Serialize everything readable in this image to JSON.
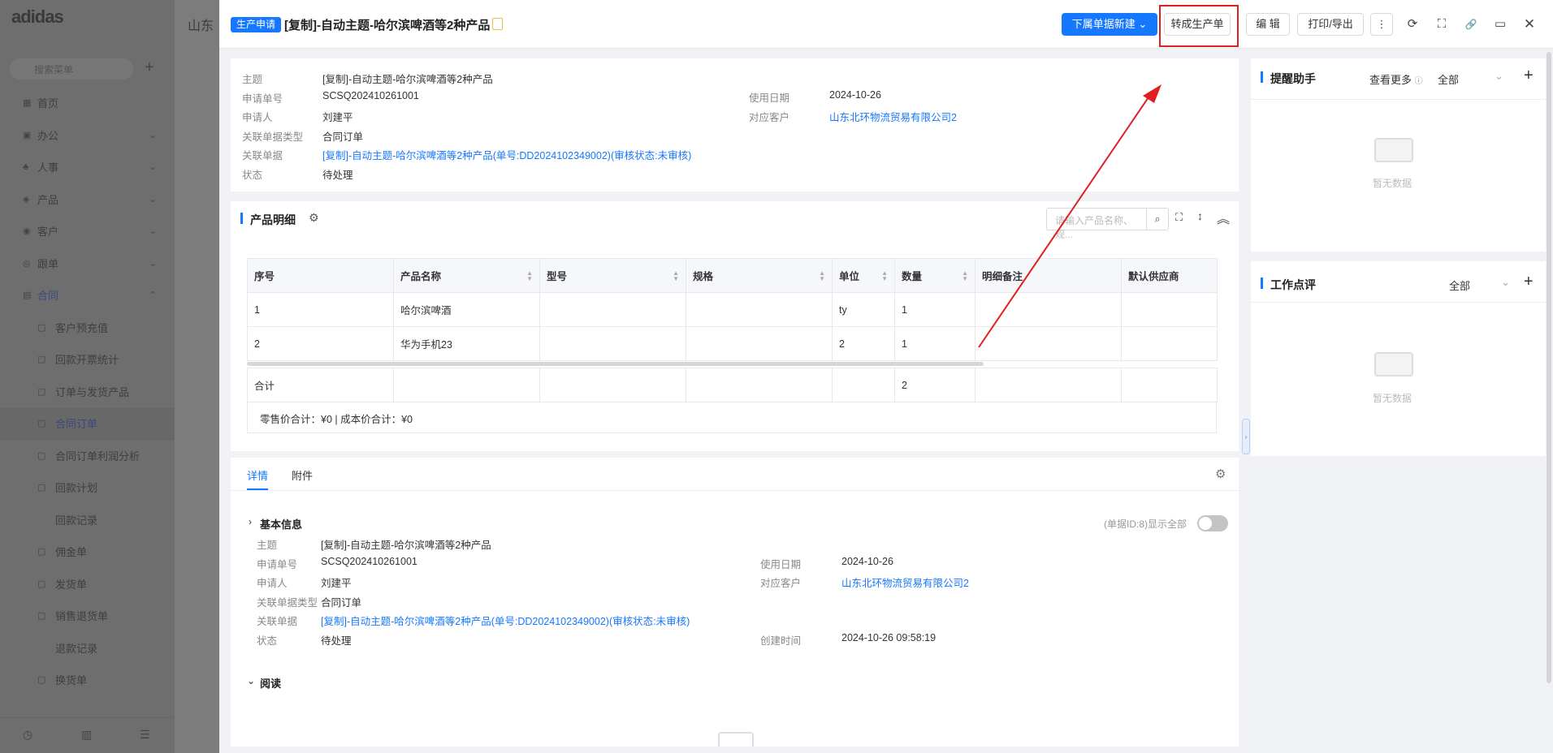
{
  "background": {
    "logo_text": "adidas",
    "search_placeholder": "搜索菜单",
    "header_text": "山东",
    "menu": [
      {
        "label": "首页",
        "icon": "▦",
        "arrow": ""
      },
      {
        "label": "办公",
        "icon": "▣",
        "arrow": "⌄"
      },
      {
        "label": "人事",
        "icon": "♣",
        "arrow": "⌄"
      },
      {
        "label": "产品",
        "icon": "◈",
        "arrow": "⌄"
      },
      {
        "label": "客户",
        "icon": "◉",
        "arrow": "⌄"
      },
      {
        "label": "跟单",
        "icon": "◎",
        "arrow": "⌄"
      },
      {
        "label": "合同",
        "icon": "▤",
        "arrow": "⌃"
      },
      {
        "label": "客户预充值",
        "icon": "▢",
        "arrow": ""
      },
      {
        "label": "回款开票统计",
        "icon": "▢",
        "arrow": ""
      },
      {
        "label": "订单与发货产品",
        "icon": "▢",
        "arrow": ""
      },
      {
        "label": "合同订单",
        "icon": "▢",
        "arrow": ""
      },
      {
        "label": "合同订单利润分析",
        "icon": "▢",
        "arrow": ""
      },
      {
        "label": "回款计划",
        "icon": "▢",
        "arrow": ""
      },
      {
        "label": "回款记录",
        "icon": "",
        "arrow": ""
      },
      {
        "label": "佣金单",
        "icon": "▢",
        "arrow": ""
      },
      {
        "label": "发货单",
        "icon": "▢",
        "arrow": ""
      },
      {
        "label": "销售退货单",
        "icon": "▢",
        "arrow": ""
      },
      {
        "label": "退款记录",
        "icon": "",
        "arrow": ""
      },
      {
        "label": "换货单",
        "icon": "▢",
        "arrow": ""
      }
    ]
  },
  "header": {
    "tag": "生产申请",
    "title": "[复制]-自动主题-哈尔滨啤酒等2种产品",
    "btn_new": "下属单据新建",
    "btn_convert": "转成生产单",
    "btn_edit": "编 辑",
    "btn_print": "打印/导出",
    "icons": {
      "more": "⋮",
      "refresh": "⟳",
      "fullscreen": "⛶",
      "link": "🔗",
      "panel": "▭",
      "close": "✕"
    }
  },
  "summary": {
    "rows": [
      {
        "label": "主题",
        "value": "[复制]-自动主题-哈尔滨啤酒等2种产品"
      },
      {
        "label": "申请单号",
        "value": "SCSQ202410261001"
      },
      {
        "label": "申请人",
        "value": "刘建平"
      },
      {
        "label": "关联单据类型",
        "value": "合同订单"
      },
      {
        "label": "关联单据",
        "value": "[复制]-自动主题-哈尔滨啤酒等2种产品(单号:DD2024102349002)(审核状态:未审核)"
      },
      {
        "label": "状态",
        "value": "待处理"
      }
    ],
    "right_rows": [
      {
        "label": "使用日期",
        "value": "2024-10-26"
      },
      {
        "label": "对应客户",
        "value": "山东北环物流贸易有限公司2"
      }
    ]
  },
  "products": {
    "title": "产品明细",
    "search_placeholder": "请输入产品名称、规...",
    "columns": [
      "序号",
      "产品名称",
      "型号",
      "规格",
      "单位",
      "数量",
      "明细备注",
      "默认供应商"
    ],
    "rows": [
      [
        "1",
        "哈尔滨啤酒",
        "",
        "",
        "ty",
        "1",
        "",
        ""
      ],
      [
        "2",
        "华为手机23",
        "",
        "",
        "2",
        "1",
        "",
        ""
      ]
    ],
    "total_label": "合计",
    "total_qty": "2",
    "footer": "零售价合计：¥0 |   成本价合计：¥0"
  },
  "details": {
    "tabs": [
      "详情",
      "附件"
    ],
    "basic_title": "基本信息",
    "doc_id": "(单据ID:8)",
    "show_all": "显示全部",
    "left_rows": [
      {
        "label": "主题",
        "value": "[复制]-自动主题-哈尔滨啤酒等2种产品"
      },
      {
        "label": "申请单号",
        "value": "SCSQ202410261001"
      },
      {
        "label": "申请人",
        "value": "刘建平"
      },
      {
        "label": "关联单据类型",
        "value": "合同订单"
      },
      {
        "label": "关联单据",
        "value": "[复制]-自动主题-哈尔滨啤酒等2种产品(单号:DD2024102349002)(审核状态:未审核)"
      },
      {
        "label": "状态",
        "value": "待处理"
      }
    ],
    "right_rows": [
      {
        "label": "使用日期",
        "value": "2024-10-26"
      },
      {
        "label": "对应客户",
        "value": "山东北环物流贸易有限公司2"
      },
      {
        "label": "创建时间",
        "value": "2024-10-26 09:58:19"
      }
    ],
    "read_title": "阅读"
  },
  "reminder": {
    "title": "提醒助手",
    "more": "查看更多",
    "filter": "全部",
    "empty": "暂无数据"
  },
  "review": {
    "title": "工作点评",
    "filter": "全部",
    "empty": "暂无数据"
  },
  "colors": {
    "primary": "#1677ff",
    "annotation": "#e02020"
  }
}
